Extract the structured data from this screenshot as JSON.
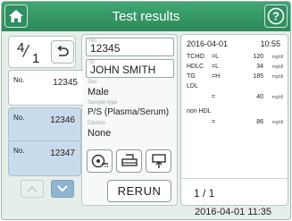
{
  "header": {
    "title": "Test results",
    "home_icon": "home-icon",
    "help_icon": "help-icon"
  },
  "counter": {
    "current": "4",
    "total": "1"
  },
  "samples": [
    {
      "no_label": "No.",
      "number": "12345"
    },
    {
      "no_label": "No.",
      "number": "12346"
    },
    {
      "no_label": "No.",
      "number": "12347"
    }
  ],
  "detail": {
    "no_label": "No.",
    "no_value": "12345",
    "id_label": "ID",
    "id_value": "JOHN SMITH",
    "sex_label": "Sex",
    "sex_value": "Male",
    "sample_type_label": "Sample type",
    "sample_type_value": "P/S (Plasma/Serum)",
    "dilution_label": "Dilution",
    "dilution_value": "None",
    "rerun_label": "RERUN"
  },
  "results": {
    "date": "2016-04-01",
    "time": "10:55",
    "rows": [
      {
        "name": "TCHO",
        "flag": "=L",
        "value": "120",
        "unit": "mg/dl"
      },
      {
        "name": "HDLC",
        "flag": "=L",
        "value": "34",
        "unit": "mg/dl"
      },
      {
        "name": "TG",
        "flag": "=H",
        "value": "185",
        "unit": "mg/dl"
      },
      {
        "name": "LDL",
        "flag": "",
        "value": "",
        "unit": ""
      },
      {
        "name": "",
        "flag": "=",
        "value": "40",
        "unit": "mg/dl"
      },
      {
        "name": "non HDL",
        "flag": "",
        "value": "",
        "unit": ""
      },
      {
        "name": "",
        "flag": "=",
        "value": "86",
        "unit": "mg/dl"
      }
    ],
    "page": "1 / 1"
  },
  "status": {
    "timestamp": "2016-04-01 11:35"
  },
  "colors": {
    "header": "#2d8a5a",
    "tab_inactive": "#c7dbeb",
    "arrow_active": "#8fb4cf"
  }
}
